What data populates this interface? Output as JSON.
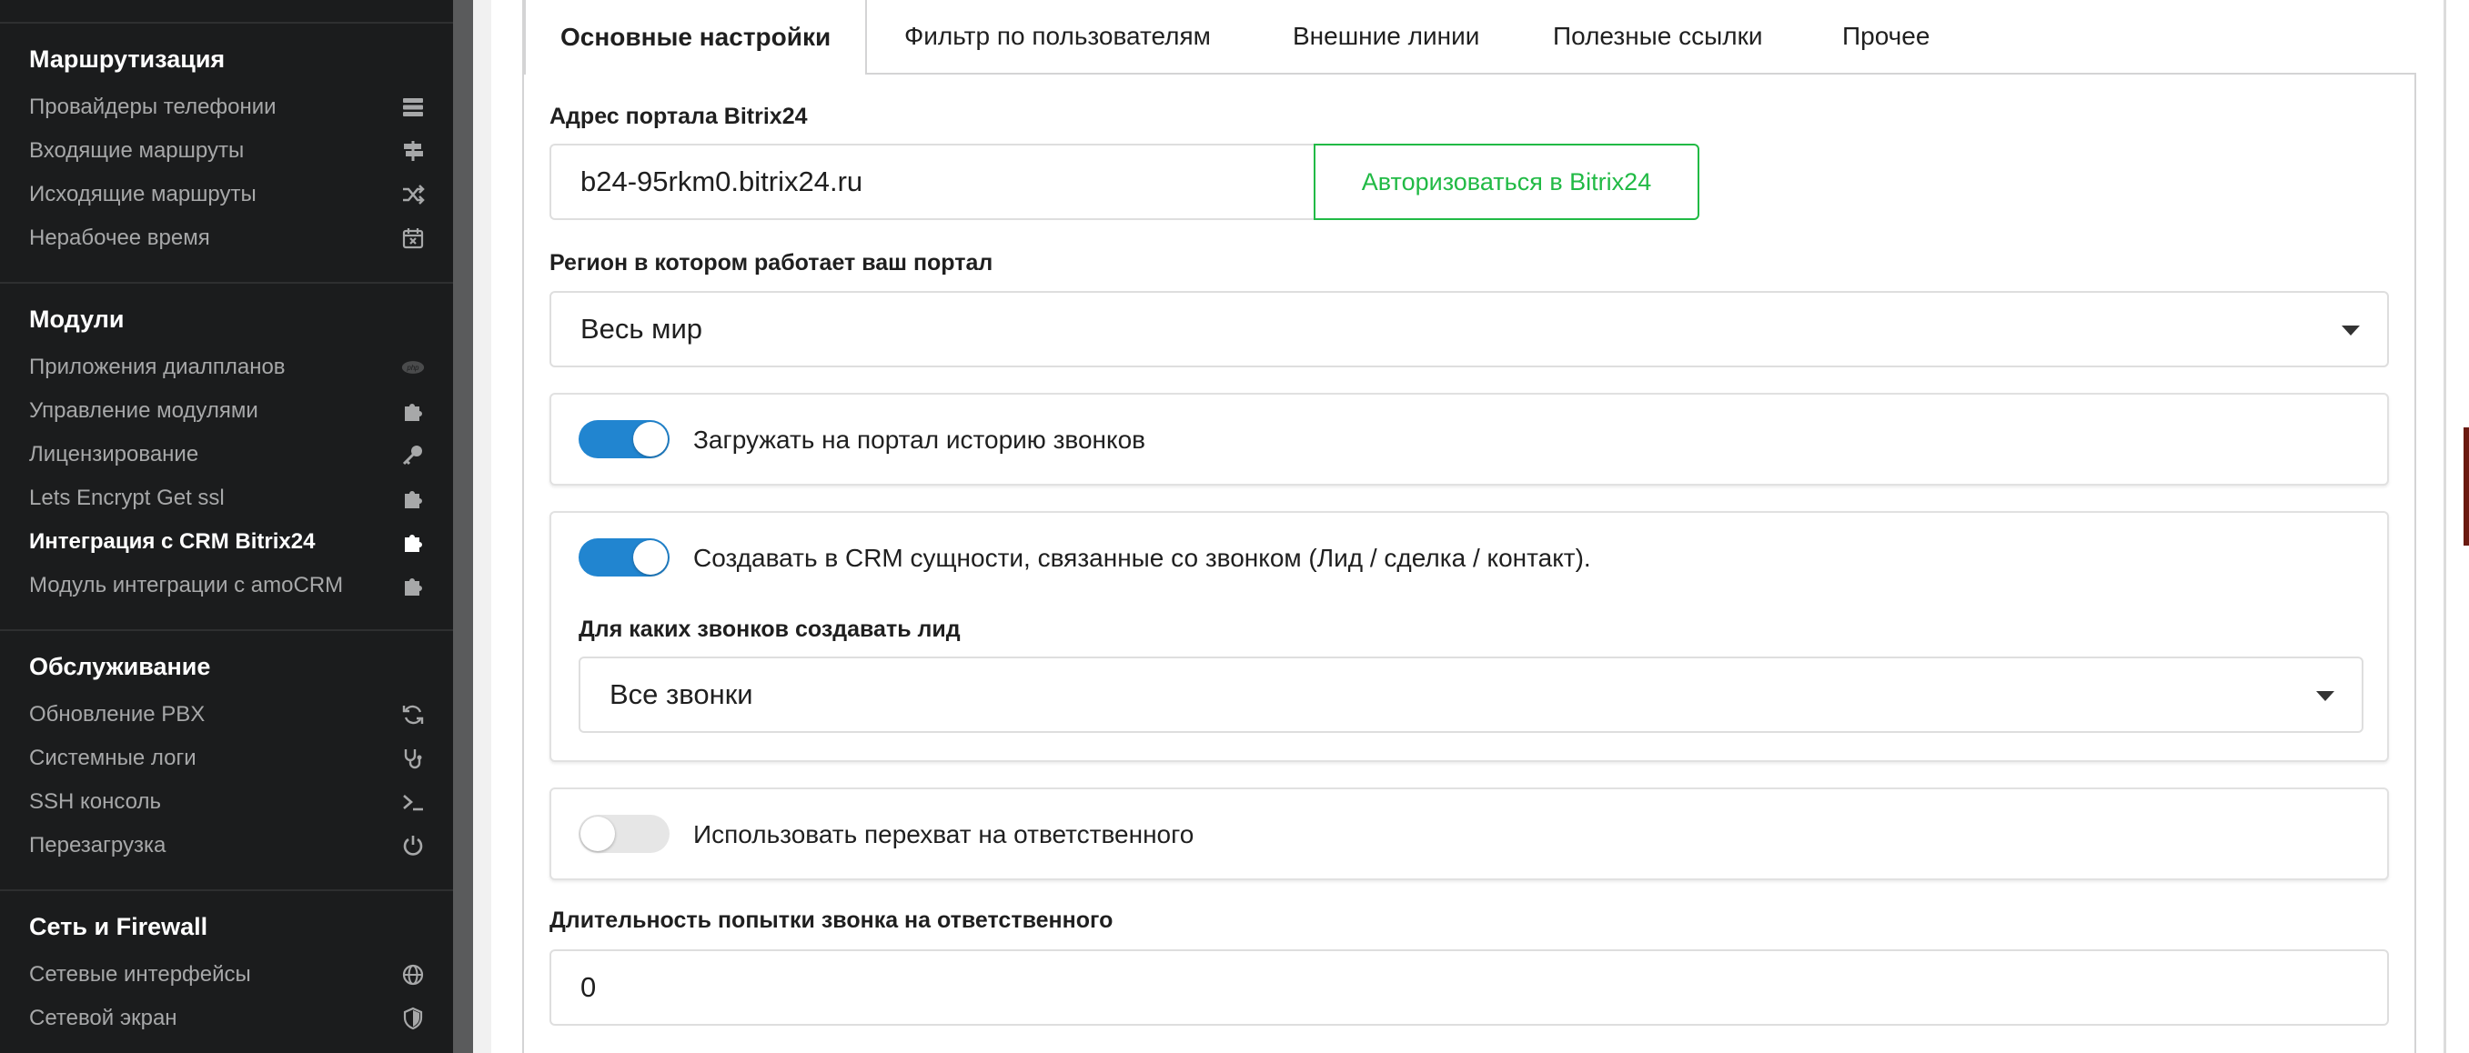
{
  "sidebar": {
    "sections": [
      {
        "title": "Маршрутизация",
        "items": [
          {
            "label": "Провайдеры телефонии",
            "icon": "server-icon"
          },
          {
            "label": "Входящие маршруты",
            "icon": "signpost-icon"
          },
          {
            "label": "Исходящие маршруты",
            "icon": "shuffle-icon"
          },
          {
            "label": "Нерабочее время",
            "icon": "calendar-x-icon"
          }
        ]
      },
      {
        "title": "Модули",
        "items": [
          {
            "label": "Приложения диалпланов",
            "icon": "php-icon"
          },
          {
            "label": "Управление модулями",
            "icon": "puzzle-icon"
          },
          {
            "label": "Лицензирование",
            "icon": "key-icon"
          },
          {
            "label": "Lets Encrypt Get ssl",
            "icon": "puzzle-icon"
          },
          {
            "label": "Интеграция с CRM Bitrix24",
            "icon": "puzzle-icon",
            "active": true
          },
          {
            "label": "Модуль интеграции с amoCRM",
            "icon": "puzzle-icon"
          }
        ]
      },
      {
        "title": "Обслуживание",
        "items": [
          {
            "label": "Обновление PBX",
            "icon": "refresh-icon"
          },
          {
            "label": "Системные логи",
            "icon": "stethoscope-icon"
          },
          {
            "label": "SSH консоль",
            "icon": "terminal-icon"
          },
          {
            "label": "Перезагрузка",
            "icon": "power-icon"
          }
        ]
      },
      {
        "title": "Сеть и Firewall",
        "items": [
          {
            "label": "Сетевые интерфейсы",
            "icon": "globe-icon"
          },
          {
            "label": "Сетевой экран",
            "icon": "shield-icon"
          }
        ]
      }
    ]
  },
  "tabs": [
    {
      "label": "Основные настройки",
      "active": true
    },
    {
      "label": "Фильтр по пользователям"
    },
    {
      "label": "Внешние линии"
    },
    {
      "label": "Полезные ссылки"
    },
    {
      "label": "Прочее"
    }
  ],
  "form": {
    "portal_label": "Адрес портала Bitrix24",
    "portal_value": "b24-95rkm0.bitrix24.ru",
    "auth_button": "Авторизоваться в Bitrix24",
    "region_label": "Регион в котором работает ваш портал",
    "region_value": "Весь мир",
    "upload_history_label": "Загружать на портал историю звонков",
    "upload_history_on": true,
    "create_crm_label": "Создавать в CRM сущности, связанные со звонком (Лид / сделка / контакт).",
    "create_crm_on": true,
    "lead_calls_label": "Для каких звонков создавать лид",
    "lead_calls_value": "Все звонки",
    "intercept_label": "Использовать перехват на ответственного",
    "intercept_on": false,
    "duration_label": "Длительность попытки звонка на ответственного",
    "duration_value": "0"
  },
  "colors": {
    "sidebar_bg": "#1b1c1d",
    "toggle_on": "#2185d0",
    "auth_green": "#21ba45"
  }
}
